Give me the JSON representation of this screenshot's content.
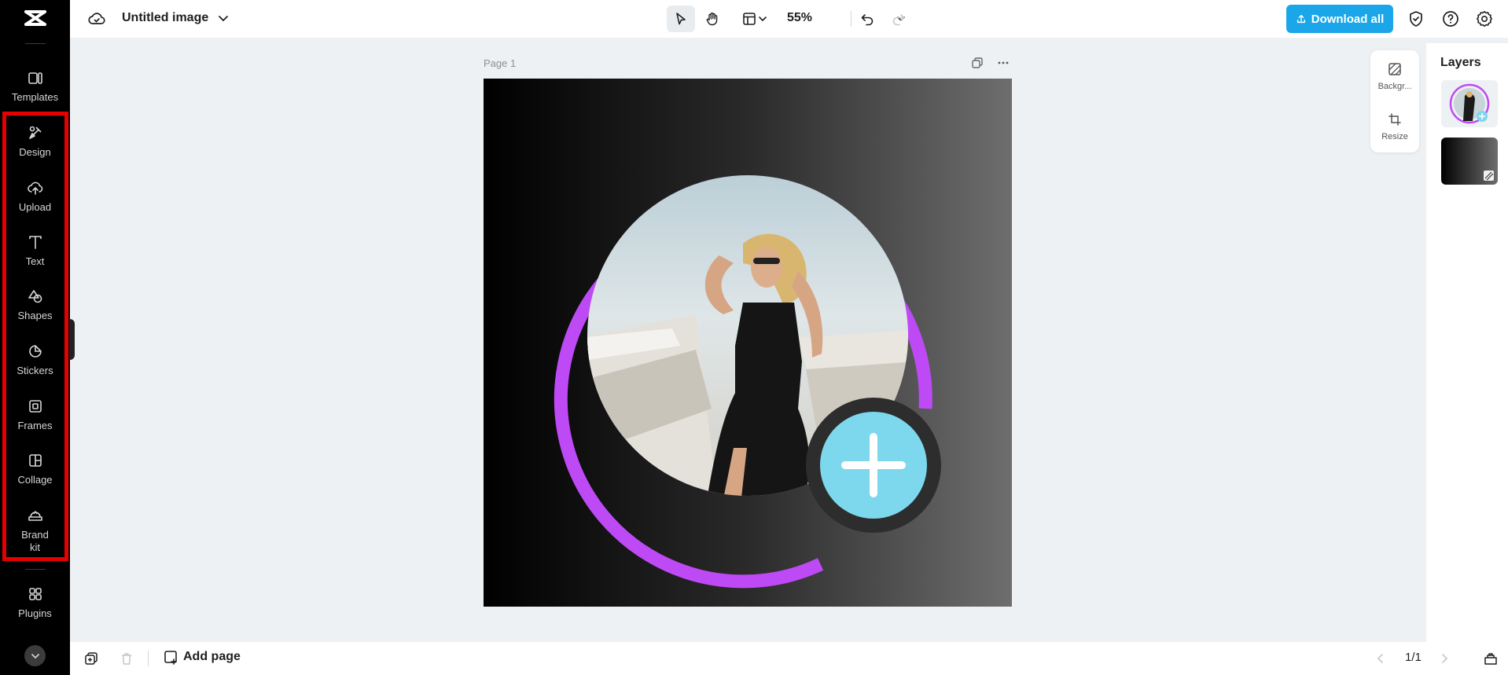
{
  "app": {
    "logo": "capcut-logo-icon"
  },
  "sidebar": {
    "items": [
      {
        "label": "Templates",
        "icon": "templates-icon"
      },
      {
        "label": "Design",
        "icon": "design-icon"
      },
      {
        "label": "Upload",
        "icon": "upload-icon"
      },
      {
        "label": "Text",
        "icon": "text-icon"
      },
      {
        "label": "Shapes",
        "icon": "shapes-icon"
      },
      {
        "label": "Stickers",
        "icon": "stickers-icon"
      },
      {
        "label": "Frames",
        "icon": "frames-icon"
      },
      {
        "label": "Collage",
        "icon": "collage-icon"
      },
      {
        "label": "Brand kit",
        "icon": "brand-kit-icon"
      },
      {
        "label": "Plugins",
        "icon": "plugins-icon"
      }
    ],
    "highlight_color": "#e60000"
  },
  "header": {
    "title": "Untitled image",
    "zoom": "55%",
    "download_label": "Download all",
    "accent": "#1aa6e8"
  },
  "canvas": {
    "page_label": "Page 1",
    "ring_color": "#bd4af5",
    "plus_color": "#7dd8ee"
  },
  "side_panel": {
    "background_label": "Backgr...",
    "resize_label": "Resize"
  },
  "layers": {
    "title": "Layers"
  },
  "footer": {
    "add_page_label": "Add page",
    "pager": "1/1"
  }
}
